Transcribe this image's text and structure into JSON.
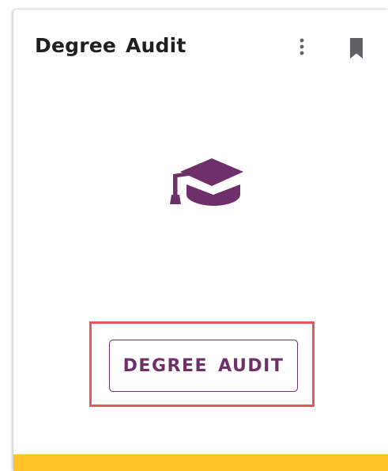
{
  "card": {
    "title": "Degree Audit",
    "menu_icon": "more-vertical-icon",
    "bookmark_icon": "bookmark-icon",
    "hero_icon": "graduation-cap-icon",
    "primary_button_label": "DEGREE AUDIT"
  },
  "colors": {
    "accent_purple": "#6e2f6b",
    "bottom_bar_yellow": "#ffc328",
    "highlight_red": "#e8575c",
    "icon_gray": "#5f6166"
  }
}
